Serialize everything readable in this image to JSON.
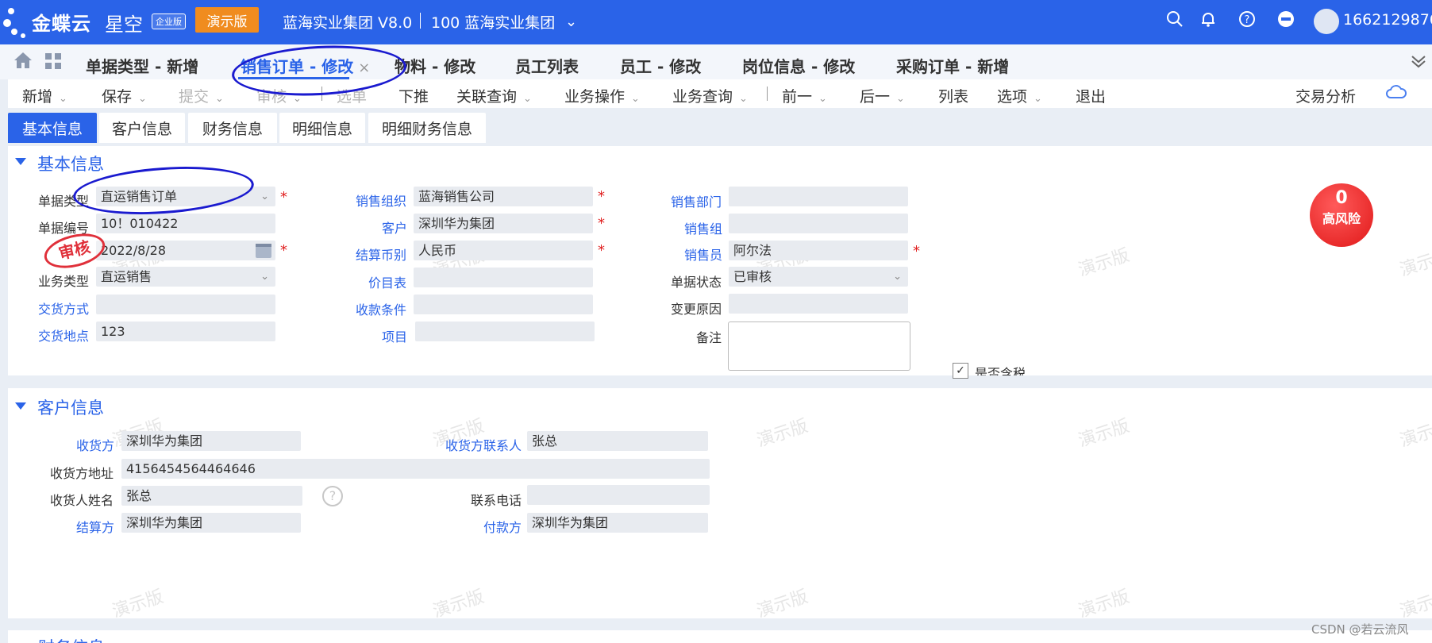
{
  "topbar": {
    "brand": "金蝶云",
    "brand_sub": "星空",
    "edition_badge": "企业版",
    "demo_button": "演示版",
    "org_name": "蓝海实业集团 V8.0",
    "org_unit": "100 蓝海实业集团",
    "user": "1662129876",
    "bg_color": "#2a63e8"
  },
  "tabs": [
    {
      "label": "单据类型 - 新增"
    },
    {
      "label": "销售订单 - 修改",
      "active": true
    },
    {
      "label": "物料 - 修改"
    },
    {
      "label": "员工列表"
    },
    {
      "label": "员工 - 修改"
    },
    {
      "label": "岗位信息 - 修改"
    },
    {
      "label": "采购订单 - 新增"
    }
  ],
  "toolbar": {
    "new": "新增",
    "save": "保存",
    "submit": "提交",
    "audit": "审核",
    "select": "选单",
    "push": "下推",
    "link_query": "关联查询",
    "biz_op": "业务操作",
    "biz_query": "业务查询",
    "prev": "前一",
    "next": "后一",
    "list": "列表",
    "options": "选项",
    "exit": "退出",
    "trade_analysis": "交易分析"
  },
  "subtabs": [
    "基本信息",
    "客户信息",
    "财务信息",
    "明细信息",
    "明细财务信息"
  ],
  "basic": {
    "title": "基本信息",
    "bill_type": {
      "label": "单据类型",
      "value": "直运销售订单"
    },
    "bill_no": {
      "label": "单据编号",
      "value": "10！010422"
    },
    "date": {
      "value": "2022/8/28"
    },
    "biz_type": {
      "label": "业务类型",
      "value": "直运销售"
    },
    "delivery_method": {
      "label": "交货方式",
      "value": ""
    },
    "delivery_place": {
      "label": "交货地点",
      "value": "123"
    },
    "sale_org": {
      "label": "销售组织",
      "value": "蓝海销售公司"
    },
    "customer": {
      "label": "客户",
      "value": "深圳华为集团"
    },
    "currency": {
      "label": "结算币别",
      "value": "人民币"
    },
    "price_list": {
      "label": "价目表",
      "value": ""
    },
    "payment_terms": {
      "label": "收款条件",
      "value": ""
    },
    "project": {
      "label": "项目",
      "value": ""
    },
    "sale_dept": {
      "label": "销售部门",
      "value": ""
    },
    "sale_group": {
      "label": "销售组",
      "value": ""
    },
    "salesman": {
      "label": "销售员",
      "value": "阿尔法"
    },
    "status": {
      "label": "单据状态",
      "value": "已审核"
    },
    "change_reason": {
      "label": "变更原因",
      "value": ""
    },
    "remark": {
      "label": "备注",
      "value": ""
    },
    "tax_included": {
      "label": "是否含税"
    },
    "stamp": "审核",
    "risk": {
      "count": "0",
      "label": "高风险"
    }
  },
  "customer": {
    "title": "客户信息",
    "receiver": {
      "label": "收货方",
      "value": "深圳华为集团"
    },
    "receiver_contact": {
      "label": "收货方联系人",
      "value": "张总"
    },
    "receiver_address": {
      "label": "收货方地址",
      "value": "4156454564464646"
    },
    "receiver_name": {
      "label": "收货人姓名",
      "value": "张总"
    },
    "phone": {
      "label": "联系电话",
      "value": ""
    },
    "settle_party": {
      "label": "结算方",
      "value": "深圳华为集团"
    },
    "payer": {
      "label": "付款方",
      "value": "深圳华为集团"
    }
  },
  "finance_peek": "财务信息",
  "watermark": "演示版",
  "footer_mark": "CSDN @若云流风"
}
